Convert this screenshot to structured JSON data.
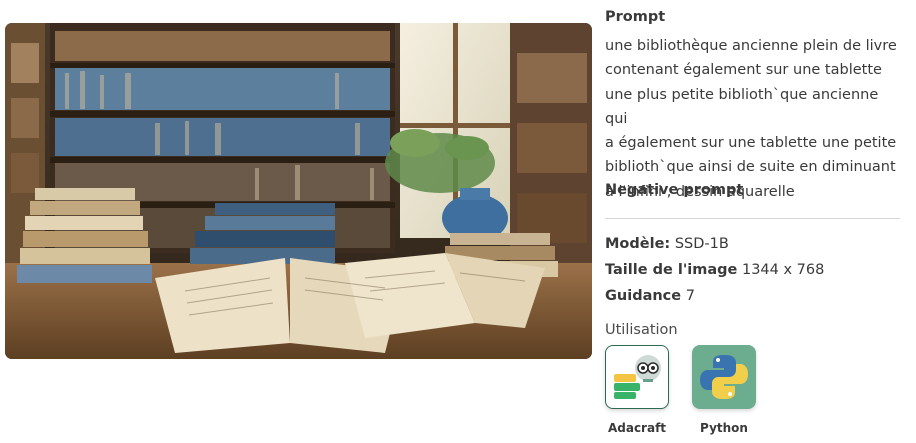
{
  "prompt": {
    "title": "Prompt",
    "lines": [
      "une bibliothèque ancienne plein de livre",
      "contenant également sur une tablette",
      "une plus petite biblioth`que ancienne qui",
      "a également sur une tablette une petite",
      "biblioth`que ainsi de suite en diminuant",
      "à l'infini , dessin aquarelle"
    ]
  },
  "negative_prompt": {
    "title": "Negative prompt"
  },
  "meta": {
    "model_label": "Modèle:",
    "model_value": "SSD-1B",
    "size_label": "Taille de l'image",
    "size_value": "1344 x 768",
    "guidance_label": "Guidance",
    "guidance_value": "7"
  },
  "usage": {
    "label": "Utilisation",
    "tools": [
      {
        "name": "Adacraft",
        "icon": "adacraft-icon"
      },
      {
        "name": "Python",
        "icon": "python-icon"
      }
    ]
  },
  "image": {
    "subject": "library-watercolor-image"
  }
}
